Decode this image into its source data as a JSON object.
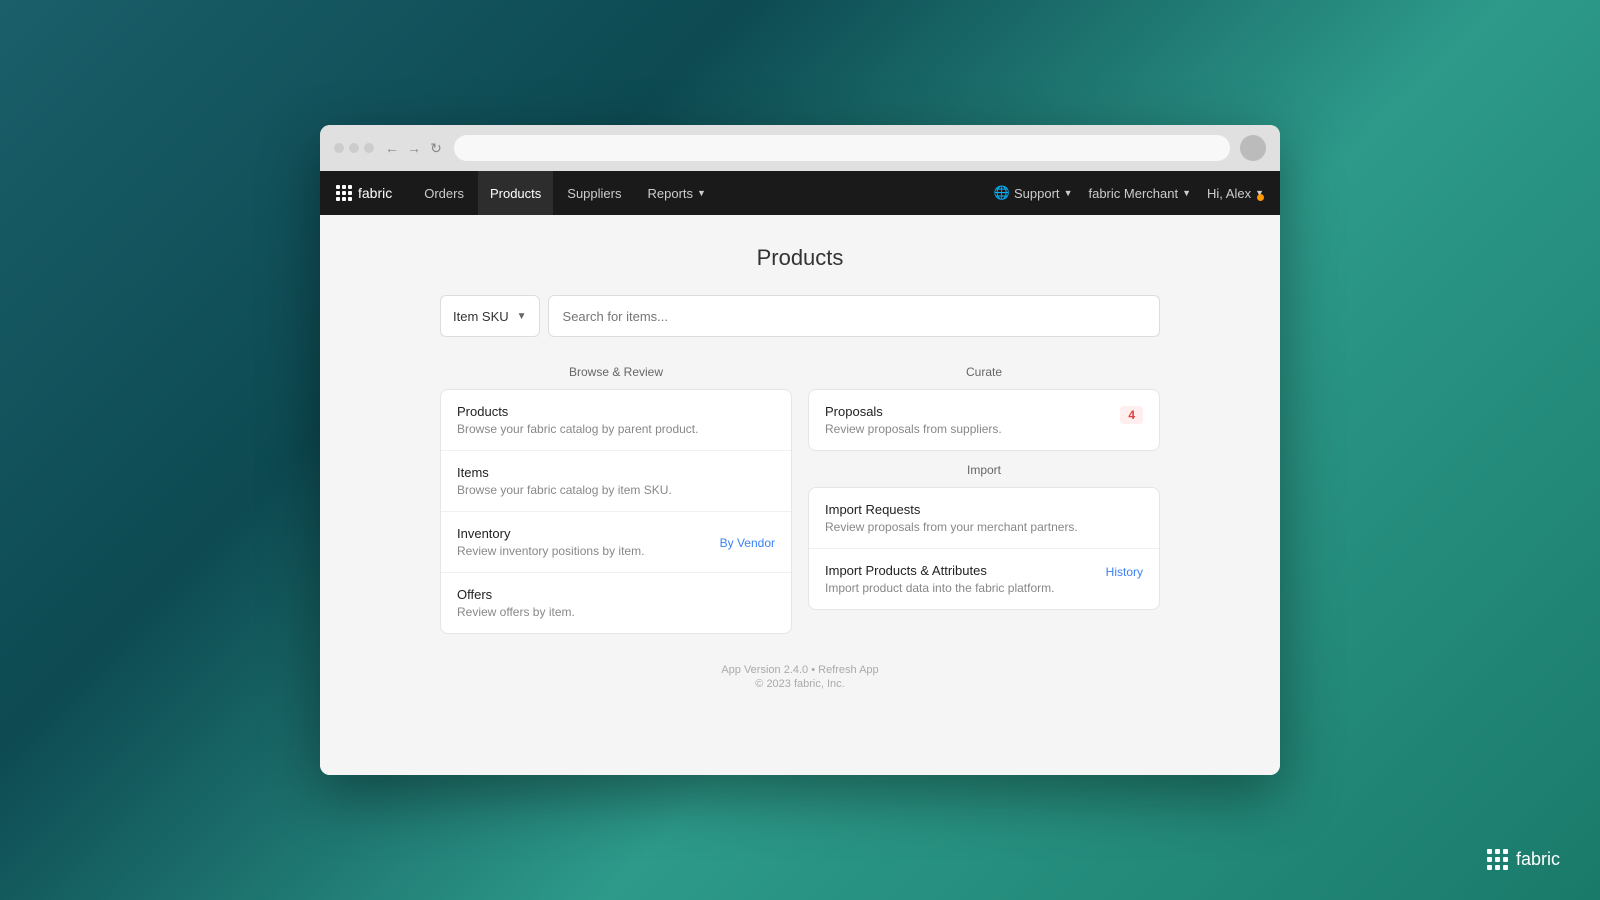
{
  "browser": {
    "address": ""
  },
  "navbar": {
    "brand": "fabric",
    "links": [
      {
        "label": "Orders",
        "active": false
      },
      {
        "label": "Products",
        "active": true
      },
      {
        "label": "Suppliers",
        "active": false
      },
      {
        "label": "Reports",
        "active": false,
        "hasArrow": true
      }
    ],
    "right": {
      "support_label": "Support",
      "merchant_label": "fabric Merchant",
      "user_label": "Hi, Alex"
    }
  },
  "main": {
    "title": "Products",
    "search": {
      "dropdown_label": "Item SKU",
      "placeholder": "Search for items..."
    },
    "browse_section": {
      "heading": "Browse & Review",
      "items": [
        {
          "title": "Products",
          "description": "Browse your fabric catalog by parent product.",
          "link": null
        },
        {
          "title": "Items",
          "description": "Browse your fabric catalog by item SKU.",
          "link": null
        },
        {
          "title": "Inventory",
          "description": "Review inventory positions by item.",
          "link": "By Vendor"
        },
        {
          "title": "Offers",
          "description": "Review offers by item.",
          "link": null
        }
      ]
    },
    "curate_section": {
      "heading": "Curate",
      "items": [
        {
          "title": "Proposals",
          "description": "Review proposals from suppliers.",
          "badge": "4"
        }
      ]
    },
    "import_section": {
      "heading": "Import",
      "items": [
        {
          "title": "Import Requests",
          "description": "Review proposals from your merchant partners.",
          "link": null
        },
        {
          "title": "Import Products & Attributes",
          "description": "Import product data into the fabric platform.",
          "link": "History"
        }
      ]
    }
  },
  "footer": {
    "version": "App Version 2.4.0 • Refresh App",
    "copyright": "© 2023 fabric, Inc."
  },
  "watermark": {
    "label": "fabric"
  }
}
